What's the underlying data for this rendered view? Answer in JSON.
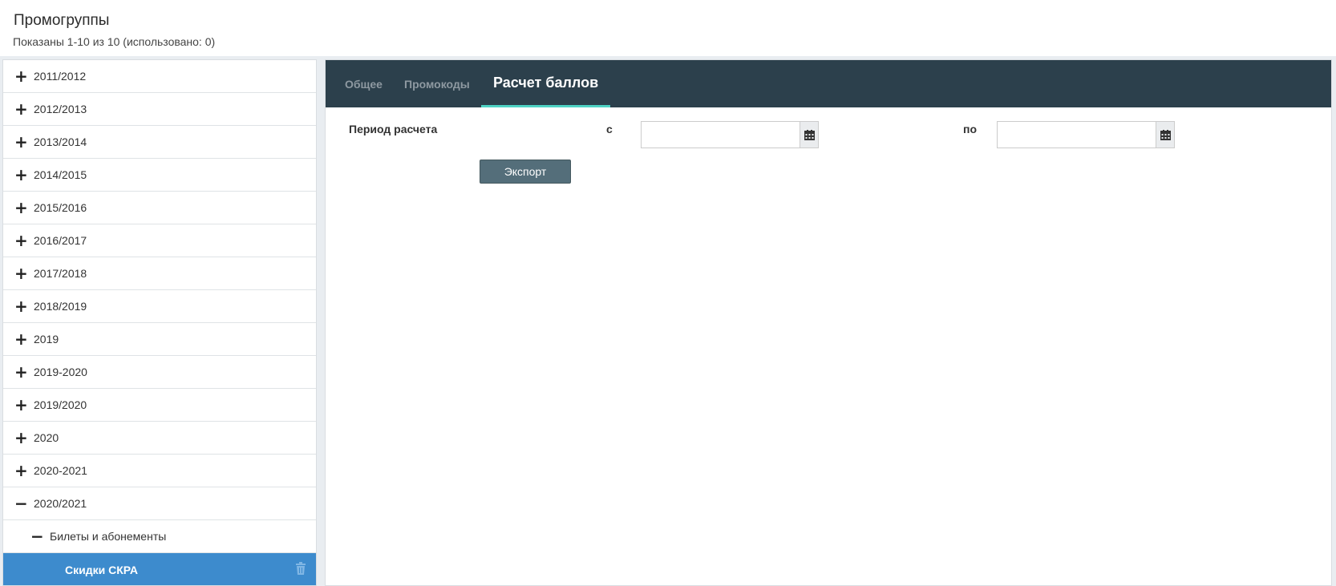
{
  "header": {
    "title": "Промогруппы",
    "subtitle": "Показаны 1-10 из 10 (использовано: 0)"
  },
  "sidebar": {
    "items": [
      {
        "label": "2011/2012",
        "toggle": "+"
      },
      {
        "label": "2012/2013",
        "toggle": "+"
      },
      {
        "label": "2013/2014",
        "toggle": "+"
      },
      {
        "label": "2014/2015",
        "toggle": "+"
      },
      {
        "label": "2015/2016",
        "toggle": "+"
      },
      {
        "label": "2016/2017",
        "toggle": "+"
      },
      {
        "label": "2017/2018",
        "toggle": "+"
      },
      {
        "label": "2018/2019",
        "toggle": "+"
      },
      {
        "label": "2019",
        "toggle": "+"
      },
      {
        "label": "2019-2020",
        "toggle": "+"
      },
      {
        "label": "2019/2020",
        "toggle": "+"
      },
      {
        "label": "2020",
        "toggle": "+"
      },
      {
        "label": "2020-2021",
        "toggle": "+"
      },
      {
        "label": "2020/2021",
        "toggle": "−"
      }
    ],
    "subgroup": {
      "label": "Билеты и абонементы",
      "toggle": "−"
    },
    "selected": {
      "label": "Скидки СКРА",
      "icon": "trash-icon"
    }
  },
  "tabs": {
    "general": "Общее",
    "promocodes": "Промокоды",
    "points": "Расчет баллов"
  },
  "form": {
    "period_label": "Период расчета",
    "from_label": "с",
    "to_label": "по",
    "from_value": "",
    "to_value": "",
    "export_label": "Экспорт"
  },
  "colors": {
    "tabbar": "#2c404c",
    "tab_underline": "#4ed3c4",
    "selected_item": "#3d8bcd",
    "export_button": "#546e7a"
  }
}
